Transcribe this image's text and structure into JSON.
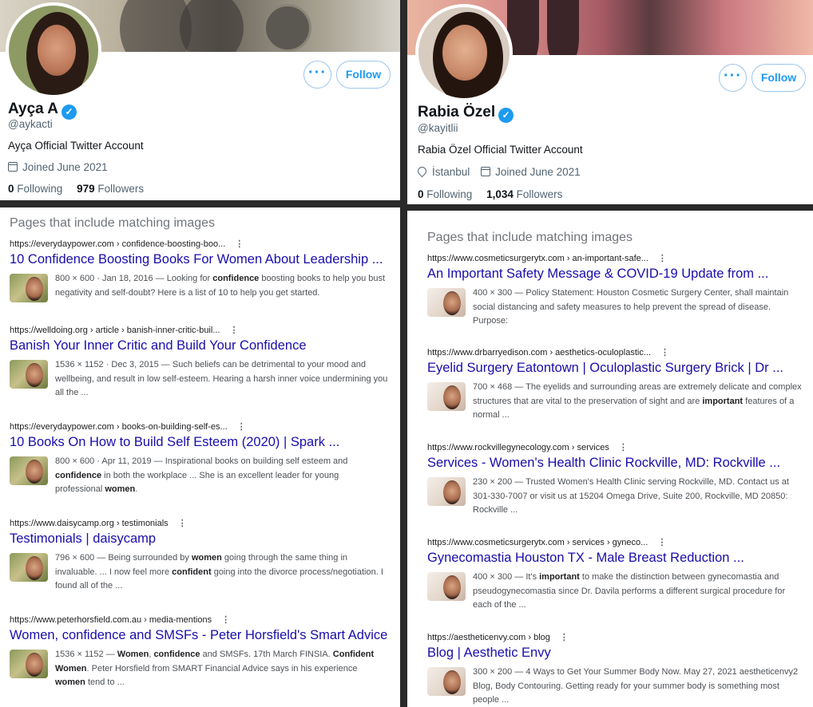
{
  "left_profile": {
    "name": "Ayça A",
    "handle": "@aykacti",
    "bio": "Ayça Official Twitter Account",
    "joined": "Joined June 2021",
    "following_count": "0",
    "following_label": "Following",
    "followers_count": "979",
    "followers_label": "Followers",
    "more_label": "···",
    "follow_label": "Follow"
  },
  "right_profile": {
    "name": "Rabia Özel",
    "handle": "@kayitlii",
    "bio": "Rabia  Özel Official Twitter Account",
    "location": "İstanbul",
    "joined": "Joined June 2021",
    "following_count": "0",
    "following_label": "Following",
    "followers_count": "1,034",
    "followers_label": "Followers",
    "more_label": "···",
    "follow_label": "Follow"
  },
  "left_results": {
    "section_title": "Pages that include matching images",
    "items": [
      {
        "url": "https://everydaypower.com › confidence-boosting-boo...",
        "title": "10 Confidence Boosting Books For Women About Leadership ...",
        "lines": [
          "800 × 600 · Jan 18, 2016 — Looking for <b>confidence</b> boosting books to help you bust",
          "negativity and self-doubt? Here is a list of 10 to help you get started."
        ]
      },
      {
        "url": "https://welldoing.org › article › banish-inner-critic-buil...",
        "title": "Banish Your Inner Critic and Build Your Confidence",
        "lines": [
          "1536 × 1152 · Dec 3, 2015 — Such beliefs can be detrimental to your mood and",
          "wellbeing, and result in low self-esteem. Hearing a harsh inner voice undermining you",
          "all the ..."
        ]
      },
      {
        "url": "https://everydaypower.com › books-on-building-self-es...",
        "title": "10 Books On How to Build Self Esteem (2020) | Spark ...",
        "lines": [
          "800 × 600 · Apr 11, 2019 — Inspirational books on building self esteem and",
          "<b>confidence</b> in both the workplace ... She is an excellent leader for young",
          "professional <b>women</b>."
        ]
      },
      {
        "url": "https://www.daisycamp.org › testimonials",
        "title": "Testimonials | daisycamp",
        "lines": [
          "796 × 600 — Being surrounded by <b>women</b> going through the same thing in",
          "invaluable. ... I now feel more <b>confident</b> going into the divorce process/negotiation. I",
          "found all of the ..."
        ]
      },
      {
        "url": "https://www.peterhorsfield.com.au › media-mentions",
        "title": "Women, confidence and SMSFs - Peter Horsfield's Smart Advice",
        "lines": [
          "1536 × 1152 — <b>Women</b>, <b>confidence</b> and SMSFs. 17th March FINSIA. <b>Confident</b>",
          "<b>Women</b>. Peter Horsfield from SMART Financial Advice says in his experience",
          "<b>women</b> tend to ..."
        ]
      }
    ]
  },
  "right_results": {
    "section_title": "Pages that include matching images",
    "items": [
      {
        "url": "https://www.cosmeticsurgerytx.com › an-important-safe...",
        "title": "An Important Safety Message & COVID-19 Update from ...",
        "lines": [
          "400 × 300 — Policy Statement: Houston Cosmetic Surgery Center, shall maintain",
          "social distancing and safety measures to help prevent the spread of disease.",
          "Purpose:"
        ]
      },
      {
        "url": "https://www.drbarryedison.com › aesthetics-oculoplastic...",
        "title": "Eyelid Surgery Eatontown | Oculoplastic Surgery Brick | Dr ...",
        "lines": [
          "700 × 468 — The eyelids and surrounding areas are extremely delicate and complex",
          "structures that are vital to the preservation of sight and are <b>important</b> features of a",
          "normal ..."
        ]
      },
      {
        "url": "https://www.rockvillegynecology.com › services",
        "title": "Services - Women's Health Clinic Rockville, MD: Rockville ...",
        "lines": [
          "230 × 200 — Trusted Women's Health Clinic serving Rockville, MD. Contact us at",
          "301-330-7007 or visit us at 15204 Omega Drive, Suite 200, Rockville, MD 20850:",
          "Rockville ..."
        ]
      },
      {
        "url": "https://www.cosmeticsurgerytx.com › services › gyneco...",
        "title": "Gynecomastia Houston TX - Male Breast Reduction ...",
        "lines": [
          "400 × 300 — It's <b>important</b> to make the distinction between gynecomastia and",
          "pseudogynecomastia since Dr. Davila performs a different surgical procedure for",
          "each of the ..."
        ]
      },
      {
        "url": "https://aestheticenvy.com › blog",
        "title": "Blog | Aesthetic Envy",
        "lines": [
          "300 × 200 — 4 Ways to Get Your Summer Body Now. May 27, 2021 aestheticenvy2",
          "Blog, Body Contouring. Getting ready for your summer body is something most",
          "people ..."
        ]
      }
    ]
  }
}
